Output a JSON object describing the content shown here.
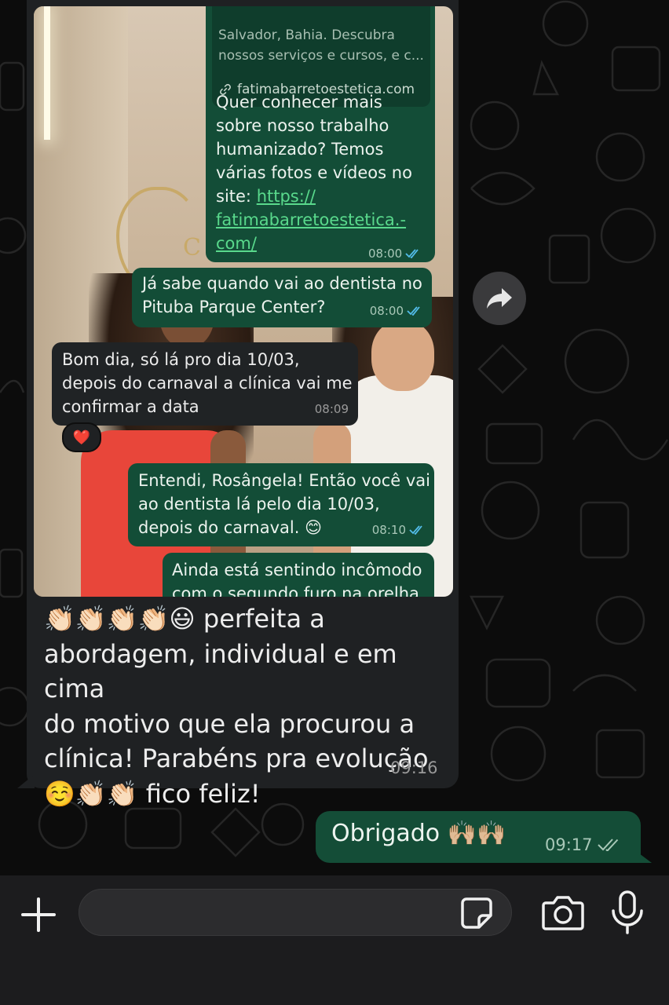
{
  "colors": {
    "outgoing_bubble": "#144d37",
    "incoming_bubble": "#1f2123",
    "link_green": "#59d98c",
    "read_tick_blue": "#53bdeb",
    "background": "#0c0c0c"
  },
  "media": {
    "photo_sign": "CL",
    "link_preview": {
      "description": "Salvador, Bahia. Descubra\nnossos serviços e cursos, e c...",
      "url": "fatimabarretoestetica.com"
    },
    "messages": [
      {
        "text": "Quer conhecer mais\nsobre nosso trabalho\nhumanizado? Temos\nvárias fotos e vídeos no\nsite: ",
        "link": "https://\nfatimabarretoestetica.-\ncom/",
        "time": "08:00"
      },
      {
        "text": "Já sabe quando vai ao dentista no\nPituba Parque Center?",
        "time": "08:00"
      },
      {
        "text": "Bom dia, só lá pro dia 10/03,\ndepois do carnaval a clínica vai me\nconfirmar a data",
        "time": "08:09",
        "reaction": "❤️"
      },
      {
        "text": "Entendi, Rosângela! Então você vai\nao dentista lá pelo dia 10/03,\ndepois do carnaval. 😊",
        "time": "08:10"
      },
      {
        "text": "Ainda está sentindo incômodo\ncom o segundo furo na orelha"
      }
    ]
  },
  "incoming_caption": {
    "text": "👏🏻👏🏻👏🏻👏🏻😃 perfeita a\nabordagem, individual e em cima\ndo motivo que ela procurou a\nclínica! Parabéns pra evolução\n☺️👏🏻👏🏻 fico feliz!",
    "time": "09:16"
  },
  "outgoing": {
    "text": "Obrigado 🙌🏼🙌🏼",
    "time": "09:17"
  },
  "composer": {
    "placeholder": ""
  },
  "icons": [
    "forward-icon",
    "plus-icon",
    "sticker-icon",
    "camera-icon",
    "microphone-icon",
    "double-check-icon",
    "link-icon"
  ]
}
